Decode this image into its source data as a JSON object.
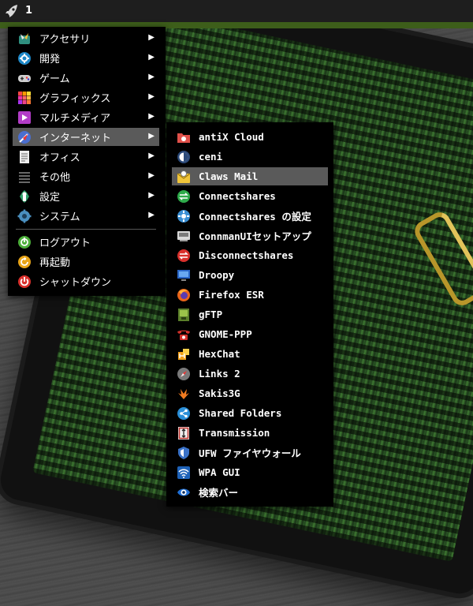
{
  "taskbar": {
    "workspace": "1"
  },
  "main_menu": {
    "items": [
      {
        "label": "アクセサリ",
        "icon": "accessories-icon",
        "submenu": true
      },
      {
        "label": "開発",
        "icon": "development-icon",
        "submenu": true
      },
      {
        "label": "ゲーム",
        "icon": "gamepad-icon",
        "submenu": true
      },
      {
        "label": "グラフィックス",
        "icon": "graphics-icon",
        "submenu": true
      },
      {
        "label": "マルチメディア",
        "icon": "multimedia-icon",
        "submenu": true
      },
      {
        "label": "インターネット",
        "icon": "internet-icon",
        "submenu": true,
        "highlighted": true
      },
      {
        "label": "オフィス",
        "icon": "office-icon",
        "submenu": true
      },
      {
        "label": "その他",
        "icon": "other-icon",
        "submenu": true
      },
      {
        "label": "設定",
        "icon": "settings-icon",
        "submenu": true
      },
      {
        "label": "システム",
        "icon": "system-icon",
        "submenu": true
      }
    ],
    "session": [
      {
        "label": "ログアウト",
        "icon": "logout-icon"
      },
      {
        "label": "再起動",
        "icon": "restart-icon"
      },
      {
        "label": "シャットダウン",
        "icon": "shutdown-icon"
      }
    ],
    "submenu_arrow": "▶"
  },
  "internet_menu": {
    "items": [
      {
        "label": "antiX Cloud",
        "icon": "cloud-folder-icon"
      },
      {
        "label": "ceni",
        "icon": "ceni-icon"
      },
      {
        "label": "Claws Mail",
        "icon": "mail-icon",
        "highlighted": true
      },
      {
        "label": "Connectshares",
        "icon": "connectshares-icon"
      },
      {
        "label": "Connectshares の設定",
        "icon": "connectshares-config-icon"
      },
      {
        "label": "ConnmanUIセットアップ",
        "icon": "network-card-icon"
      },
      {
        "label": "Disconnectshares",
        "icon": "disconnectshares-icon"
      },
      {
        "label": "Droopy",
        "icon": "monitor-icon"
      },
      {
        "label": "Firefox ESR",
        "icon": "firefox-icon"
      },
      {
        "label": "gFTP",
        "icon": "gftp-icon"
      },
      {
        "label": "GNOME-PPP",
        "icon": "phone-icon"
      },
      {
        "label": "HexChat",
        "icon": "hexchat-icon"
      },
      {
        "label": "Links 2",
        "icon": "compass-icon"
      },
      {
        "label": "Sakis3G",
        "icon": "sakis3g-icon"
      },
      {
        "label": "Shared Folders",
        "icon": "share-icon"
      },
      {
        "label": "Transmission",
        "icon": "transmission-icon"
      },
      {
        "label": "UFW ファイヤウォール",
        "icon": "shield-icon"
      },
      {
        "label": "WPA GUI",
        "icon": "wifi-icon"
      },
      {
        "label": "検索バー",
        "icon": "search-eye-icon"
      }
    ]
  }
}
